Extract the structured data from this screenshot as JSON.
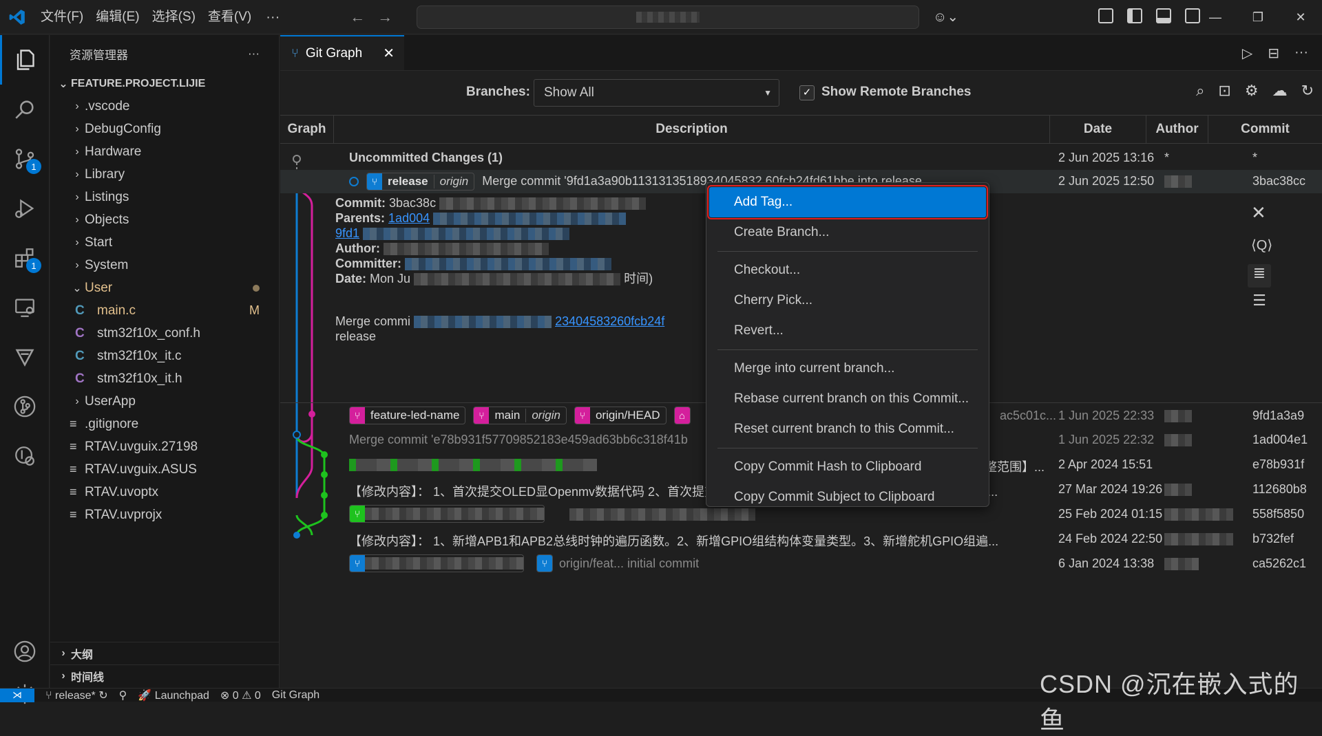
{
  "menubar": {
    "items": [
      "文件(F)",
      "编辑(E)",
      "选择(S)",
      "查看(V)"
    ],
    "more": "···"
  },
  "window_controls": {
    "minimize": "—",
    "restore": "❐",
    "close": "✕"
  },
  "activity_bar": {
    "source_control_badge": "1",
    "extensions_badge": "1"
  },
  "explorer": {
    "title": "资源管理器",
    "more": "···",
    "folder": "FEATURE.PROJECT.LIJIE",
    "items": [
      {
        "label": ".vscode",
        "type": "folder"
      },
      {
        "label": "DebugConfig",
        "type": "folder"
      },
      {
        "label": "Hardware",
        "type": "folder"
      },
      {
        "label": "Library",
        "type": "folder"
      },
      {
        "label": "Listings",
        "type": "folder"
      },
      {
        "label": "Objects",
        "type": "folder"
      },
      {
        "label": "Start",
        "type": "folder"
      },
      {
        "label": "System",
        "type": "folder"
      },
      {
        "label": "User",
        "type": "folder-open"
      },
      {
        "label": "main.c",
        "type": "c-file",
        "status": "M"
      },
      {
        "label": "stm32f10x_conf.h",
        "type": "h-file"
      },
      {
        "label": "stm32f10x_it.c",
        "type": "c-file"
      },
      {
        "label": "stm32f10x_it.h",
        "type": "h-file"
      },
      {
        "label": "UserApp",
        "type": "folder"
      },
      {
        "label": ".gitignore",
        "type": "file"
      },
      {
        "label": "RTAV.uvguix.27198",
        "type": "file"
      },
      {
        "label": "RTAV.uvguix.ASUS",
        "type": "file"
      },
      {
        "label": "RTAV.uvoptx",
        "type": "file"
      },
      {
        "label": "RTAV.uvprojx",
        "type": "file"
      }
    ],
    "outline": "大纲",
    "timeline": "时间线"
  },
  "tab": {
    "label": "Git Graph",
    "close": "✕"
  },
  "git_graph": {
    "branches_label": "Branches:",
    "branches_value": "Show All",
    "show_remote_label": "Show Remote Branches",
    "show_remote_checked": true,
    "columns": [
      "Graph",
      "Description",
      "Date",
      "Author",
      "Commit"
    ],
    "rows": [
      {
        "desc": "Uncommitted Changes (1)",
        "date": "2 Jun 2025 13:16",
        "author": "*",
        "commit": "*"
      },
      {
        "refs": [
          {
            "name": "release",
            "remote": "origin"
          }
        ],
        "desc": "Merge commit '9fd1a3a90b1131313518934045832 60fcb24fd61bbe into release",
        "date": "2 Jun 2025 12:50",
        "author": "",
        "commit": "3bac38cc"
      },
      {
        "refs": [
          {
            "name": "feature-led-name"
          },
          {
            "name": "main",
            "remote": "origin"
          },
          {
            "name": "origin/HEAD"
          }
        ],
        "desc": "ac5c01c...",
        "date": "1 Jun 2025 22:33",
        "author": "",
        "commit": "9fd1a3a9"
      },
      {
        "desc": "Merge commit 'e78b931f57709852183e459ad63bb6c318f41b",
        "date": "1 Jun 2025 22:32",
        "author": "",
        "commit": "1ad004e1"
      },
      {
        "desc": "改OLED显示...调整范围】...",
        "date": "2 Apr 2024 15:51",
        "author": "",
        "commit": "e78b931f"
      },
      {
        "desc": "【修改内容】： 1、首次提交OLED显Openmv数据代码 2、首次提交蓝牙通信代码 3、增加舵机初始化、电机初始化代...",
        "date": "27 Mar 2024 19:26",
        "author": "",
        "commit": "112680b8"
      },
      {
        "desc": "",
        "date": "25 Feb 2024 01:15",
        "author": "",
        "commit": "558f5850"
      },
      {
        "desc": "【修改内容】： 1、新增APB1和APB2总线时钟的遍历函数。2、新增GPIO组结构体变量类型。3、新增舵机GPIO组遍...",
        "date": "24 Feb 2024 22:50",
        "author": "",
        "commit": "b732fef"
      },
      {
        "desc": "origin/feat...  initial commit",
        "date": "6 Jan 2024 13:38",
        "author": "",
        "commit": "ca5262c1"
      }
    ],
    "details": {
      "commit_label": "Commit:",
      "commit_value": "3bac38c",
      "parents_label": "Parents:",
      "parent_1": "1ad004",
      "parent_2": "9fd1",
      "author_label": "Author:",
      "committer_label": "Committer:",
      "date_label": "Date:",
      "date_value": "Mon Ju",
      "date_suffix": "时间)",
      "message_1": "Merge commi",
      "message_hash": "23404583260fcb24f",
      "message_2": "release",
      "close": "✕"
    }
  },
  "context_menu": {
    "groups": [
      [
        "Add Tag...",
        "Create Branch..."
      ],
      [
        "Checkout...",
        "Cherry Pick...",
        "Revert..."
      ],
      [
        "Merge into current branch...",
        "Rebase current branch on this Commit...",
        "Reset current branch to this Commit..."
      ],
      [
        "Copy Commit Hash to Clipboard",
        "Copy Commit Subject to Clipboard"
      ]
    ]
  },
  "statusbar": {
    "branch": "release*",
    "launchpad": "Launchpad",
    "problems": "⊗ 0 ⚠ 0",
    "git_graph": "Git Graph"
  },
  "watermark": "CSDN @沉在嵌入式的鱼",
  "colors": {
    "accent": "#0078d4",
    "magenta": "#d41f9c",
    "green": "#1ec21e",
    "blue_line": "#0e7dd3"
  }
}
